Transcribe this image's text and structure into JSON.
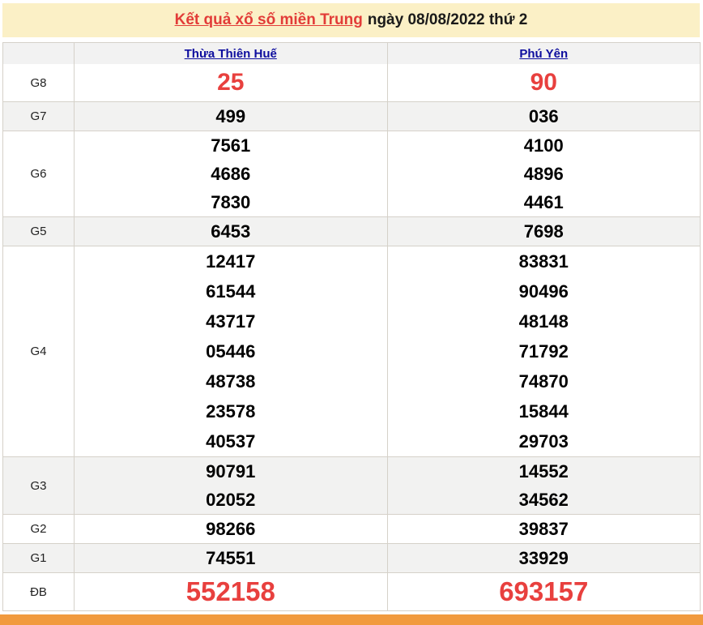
{
  "title": {
    "link_text": "Kết quả xổ số miền Trung",
    "suffix_text": "ngày 08/08/2022 thứ 2"
  },
  "table": {
    "province_columns": [
      "Thừa Thiên Huế",
      "Phú Yên"
    ],
    "rows": [
      {
        "label": "G8",
        "emphasis": "red-large",
        "hue": [
          "25"
        ],
        "phu_yen": [
          "90"
        ]
      },
      {
        "label": "G7",
        "emphasis": "none",
        "hue": [
          "499"
        ],
        "phu_yen": [
          "036"
        ]
      },
      {
        "label": "G6",
        "emphasis": "none",
        "hue": [
          "7561",
          "4686",
          "7830"
        ],
        "phu_yen": [
          "4100",
          "4896",
          "4461"
        ]
      },
      {
        "label": "G5",
        "emphasis": "none",
        "hue": [
          "6453"
        ],
        "phu_yen": [
          "7698"
        ]
      },
      {
        "label": "G4",
        "emphasis": "none",
        "hue": [
          "12417",
          "61544",
          "43717",
          "05446",
          "48738",
          "23578",
          "40537"
        ],
        "phu_yen": [
          "83831",
          "90496",
          "48148",
          "71792",
          "74870",
          "15844",
          "29703"
        ]
      },
      {
        "label": "G3",
        "emphasis": "none",
        "hue": [
          "90791",
          "02052"
        ],
        "phu_yen": [
          "14552",
          "34562"
        ]
      },
      {
        "label": "G2",
        "emphasis": "none",
        "hue": [
          "98266"
        ],
        "phu_yen": [
          "39837"
        ]
      },
      {
        "label": "G1",
        "emphasis": "none",
        "hue": [
          "74551"
        ],
        "phu_yen": [
          "33929"
        ]
      },
      {
        "label": "ĐB",
        "emphasis": "red-large",
        "hue": [
          "552158"
        ],
        "phu_yen": [
          "693157"
        ]
      }
    ]
  },
  "colors": {
    "title_bar_bg": "#fbf0c6",
    "title_link_red": "#e23c38",
    "number_red": "#e8403e",
    "header_link_blue": "#0d0d9e",
    "stripe_gray": "#f2f2f1",
    "border_gray": "#d5d1c9",
    "footer_orange": "#f19a3e"
  }
}
